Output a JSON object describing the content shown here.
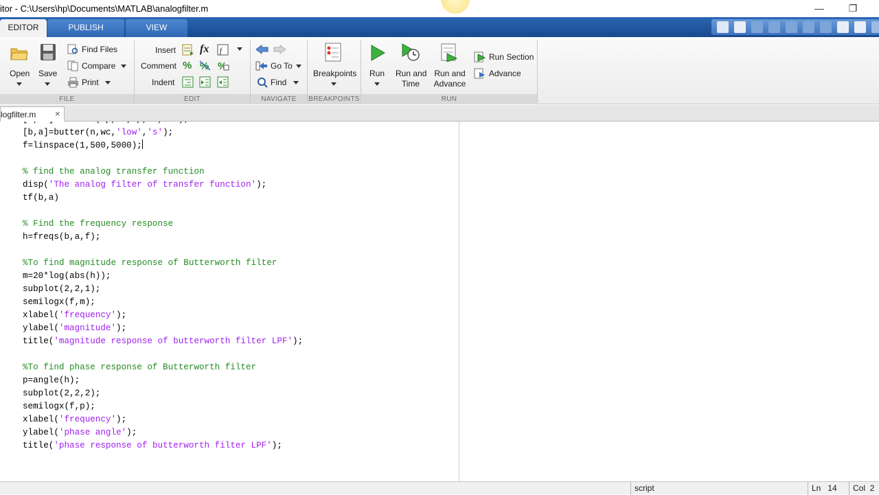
{
  "window": {
    "title": "itor - C:\\Users\\hp\\Documents\\MATLAB\\analogfilter.m",
    "minimize_glyph": "—",
    "restore_glyph": "❐"
  },
  "ribbon": {
    "tabs": [
      {
        "label": "EDITOR",
        "active": true
      },
      {
        "label": "PUBLISH",
        "active": false
      },
      {
        "label": "VIEW",
        "active": false
      }
    ]
  },
  "toolstrip": {
    "file": {
      "section_label": "FILE",
      "open": "Open",
      "save": "Save",
      "find_files": "Find Files",
      "compare": "Compare",
      "print": "Print"
    },
    "edit": {
      "section_label": "EDIT",
      "insert": "Insert",
      "comment": "Comment",
      "indent": "Indent",
      "fx": "fx"
    },
    "navigate": {
      "section_label": "NAVIGATE",
      "go_to": "Go To",
      "find": "Find"
    },
    "breakpoints": {
      "section_label": "BREAKPOINTS",
      "breakpoints": "Breakpoints"
    },
    "run": {
      "section_label": "RUN",
      "run": "Run",
      "run_and_time_1": "Run and",
      "run_and_time_2": "Time",
      "run_and_advance_1": "Run and",
      "run_and_advance_2": "Advance",
      "run_section": "Run Section",
      "advance": "Advance"
    }
  },
  "document_tab": {
    "name": "logfilter.m",
    "close": "×"
  },
  "code_lines": [
    {
      "parts": [
        {
          "t": "[a,wc]=buttord(wp,ws,rp,rs,'s');",
          "c": "n"
        }
      ]
    },
    {
      "parts": [
        {
          "t": "[b,a]=butter(n,wc,",
          "c": "n"
        },
        {
          "t": "'low'",
          "c": "s"
        },
        {
          "t": ",",
          "c": "n"
        },
        {
          "t": "'s'",
          "c": "s"
        },
        {
          "t": ");",
          "c": "n"
        }
      ]
    },
    {
      "parts": [
        {
          "t": "f=linspace(1,500,5000);",
          "c": "n"
        }
      ],
      "cursor": true
    },
    {
      "parts": []
    },
    {
      "parts": [
        {
          "t": "% find the analog transfer function",
          "c": "c"
        }
      ]
    },
    {
      "parts": [
        {
          "t": "disp(",
          "c": "n"
        },
        {
          "t": "'The analog filter of transfer function'",
          "c": "s"
        },
        {
          "t": ");",
          "c": "n"
        }
      ]
    },
    {
      "parts": [
        {
          "t": "tf(b,a)",
          "c": "n"
        }
      ]
    },
    {
      "parts": []
    },
    {
      "parts": [
        {
          "t": "% Find the frequency response",
          "c": "c"
        }
      ]
    },
    {
      "parts": [
        {
          "t": "h=freqs(b,a,f);",
          "c": "n"
        }
      ]
    },
    {
      "parts": []
    },
    {
      "parts": [
        {
          "t": "%To find magnitude response of Butterworth filter",
          "c": "c"
        }
      ]
    },
    {
      "parts": [
        {
          "t": "m=20*log(abs(h));",
          "c": "n"
        }
      ]
    },
    {
      "parts": [
        {
          "t": "subplot(2,2,1);",
          "c": "n"
        }
      ]
    },
    {
      "parts": [
        {
          "t": "semilogx(f,m);",
          "c": "n"
        }
      ]
    },
    {
      "parts": [
        {
          "t": "xlabel(",
          "c": "n"
        },
        {
          "t": "'frequency'",
          "c": "s"
        },
        {
          "t": ");",
          "c": "n"
        }
      ]
    },
    {
      "parts": [
        {
          "t": "ylabel(",
          "c": "n"
        },
        {
          "t": "'magnitude'",
          "c": "s"
        },
        {
          "t": ");",
          "c": "n"
        }
      ]
    },
    {
      "parts": [
        {
          "t": "title(",
          "c": "n"
        },
        {
          "t": "'magnitude response of butterworth filter LPF'",
          "c": "s"
        },
        {
          "t": ");",
          "c": "n"
        }
      ]
    },
    {
      "parts": []
    },
    {
      "parts": [
        {
          "t": "%To find phase response of Butterworth filter",
          "c": "c"
        }
      ]
    },
    {
      "parts": [
        {
          "t": "p=angle(h);",
          "c": "n"
        }
      ]
    },
    {
      "parts": [
        {
          "t": "subplot(2,2,2);",
          "c": "n"
        }
      ]
    },
    {
      "parts": [
        {
          "t": "semilogx(f,p);",
          "c": "n"
        }
      ]
    },
    {
      "parts": [
        {
          "t": "xlabel(",
          "c": "n"
        },
        {
          "t": "'frequency'",
          "c": "s"
        },
        {
          "t": ");",
          "c": "n"
        }
      ]
    },
    {
      "parts": [
        {
          "t": "ylabel(",
          "c": "n"
        },
        {
          "t": "'phase angle'",
          "c": "s"
        },
        {
          "t": ");",
          "c": "n"
        }
      ]
    },
    {
      "parts": [
        {
          "t": "title(",
          "c": "n"
        },
        {
          "t": "'phase response of butterworth filter LPF'",
          "c": "s"
        },
        {
          "t": ");",
          "c": "n"
        }
      ]
    }
  ],
  "status": {
    "file_type": "script",
    "ln_label": "Ln",
    "ln_value": "14",
    "col_label": "Col",
    "col_value": "2"
  },
  "colors": {
    "string": "#a020f0",
    "comment": "#228b22",
    "ribbon_blue": "#1f5aa6"
  }
}
